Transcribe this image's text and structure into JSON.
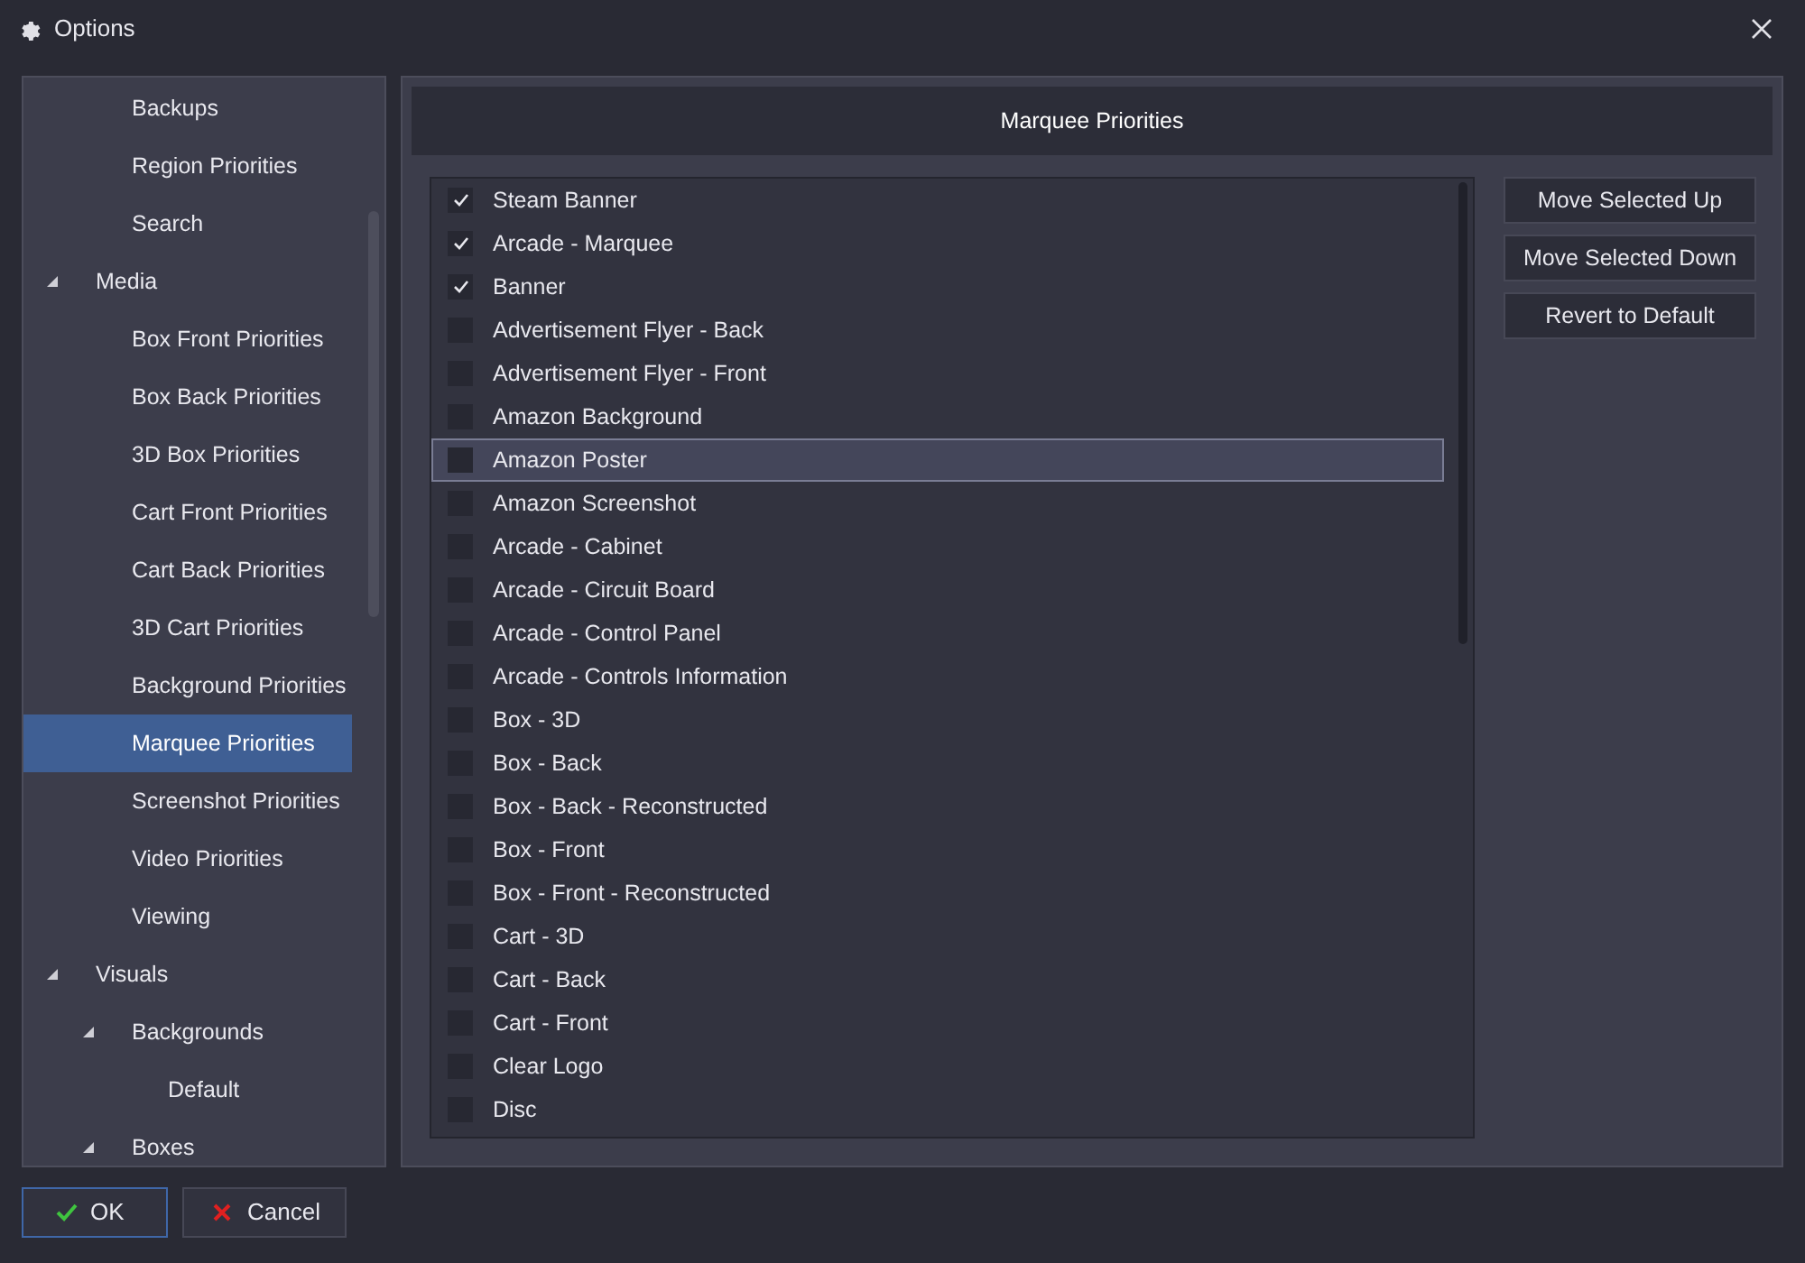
{
  "window": {
    "title": "Options"
  },
  "sidebar": {
    "continued_items": [
      {
        "label": "Backups",
        "selected": false
      },
      {
        "label": "Region Priorities",
        "selected": false
      },
      {
        "label": "Search",
        "selected": false
      }
    ],
    "tree": [
      {
        "label": "Media",
        "expanded": true,
        "selected": false,
        "children": [
          {
            "label": "Box Front Priorities",
            "selected": false
          },
          {
            "label": "Box Back Priorities",
            "selected": false
          },
          {
            "label": "3D Box Priorities",
            "selected": false
          },
          {
            "label": "Cart Front Priorities",
            "selected": false
          },
          {
            "label": "Cart Back Priorities",
            "selected": false
          },
          {
            "label": "3D Cart Priorities",
            "selected": false
          },
          {
            "label": "Background Priorities",
            "selected": false
          },
          {
            "label": "Marquee Priorities",
            "selected": true
          },
          {
            "label": "Screenshot Priorities",
            "selected": false
          },
          {
            "label": "Video Priorities",
            "selected": false
          },
          {
            "label": "Viewing",
            "selected": false
          }
        ]
      },
      {
        "label": "Visuals",
        "expanded": true,
        "selected": false,
        "children": [
          {
            "label": "Backgrounds",
            "expanded": true,
            "selected": false,
            "children": [
              {
                "label": "Default",
                "selected": false
              }
            ]
          },
          {
            "label": "Boxes",
            "expanded": true,
            "selected": false
          }
        ]
      }
    ]
  },
  "panel": {
    "title": "Marquee Priorities",
    "items": [
      {
        "label": "Steam Banner",
        "checked": true,
        "selected": false
      },
      {
        "label": "Arcade - Marquee",
        "checked": true,
        "selected": false
      },
      {
        "label": "Banner",
        "checked": true,
        "selected": false
      },
      {
        "label": "Advertisement Flyer - Back",
        "checked": false,
        "selected": false
      },
      {
        "label": "Advertisement Flyer - Front",
        "checked": false,
        "selected": false
      },
      {
        "label": "Amazon Background",
        "checked": false,
        "selected": false
      },
      {
        "label": "Amazon Poster",
        "checked": false,
        "selected": true
      },
      {
        "label": "Amazon Screenshot",
        "checked": false,
        "selected": false
      },
      {
        "label": "Arcade - Cabinet",
        "checked": false,
        "selected": false
      },
      {
        "label": "Arcade - Circuit Board",
        "checked": false,
        "selected": false
      },
      {
        "label": "Arcade - Control Panel",
        "checked": false,
        "selected": false
      },
      {
        "label": "Arcade - Controls Information",
        "checked": false,
        "selected": false
      },
      {
        "label": "Box - 3D",
        "checked": false,
        "selected": false
      },
      {
        "label": "Box - Back",
        "checked": false,
        "selected": false
      },
      {
        "label": "Box - Back - Reconstructed",
        "checked": false,
        "selected": false
      },
      {
        "label": "Box - Front",
        "checked": false,
        "selected": false
      },
      {
        "label": "Box - Front - Reconstructed",
        "checked": false,
        "selected": false
      },
      {
        "label": "Cart - 3D",
        "checked": false,
        "selected": false
      },
      {
        "label": "Cart - Back",
        "checked": false,
        "selected": false
      },
      {
        "label": "Cart - Front",
        "checked": false,
        "selected": false
      },
      {
        "label": "Clear Logo",
        "checked": false,
        "selected": false
      },
      {
        "label": "Disc",
        "checked": false,
        "selected": false
      }
    ],
    "buttons": [
      "Move Selected Up",
      "Move Selected Down",
      "Revert to Default"
    ]
  },
  "footer": {
    "ok": "OK",
    "cancel": "Cancel"
  }
}
